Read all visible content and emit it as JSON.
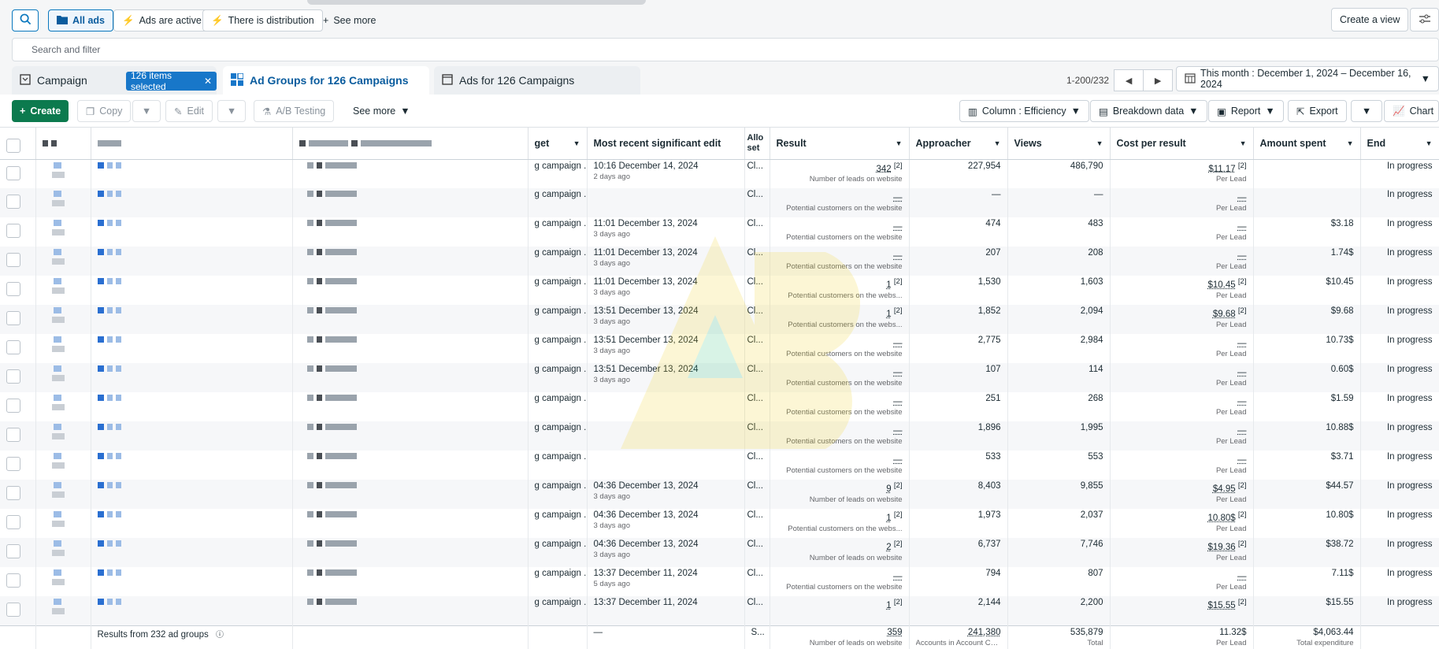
{
  "topbar": {
    "all_ads": "All ads",
    "ads_active": "Ads are active",
    "distribution": "There is distribution",
    "see_more": "See more",
    "create_view": "Create a view"
  },
  "search": {
    "placeholder": "Search and filter"
  },
  "tabs": {
    "campaign": "Campaign",
    "selected_badge": "126 items selected",
    "ad_groups": "Ad Groups for 126 Campaigns",
    "ads": "Ads for 126 Campaigns"
  },
  "pager": {
    "range": "1-200/232"
  },
  "date_range": "This month : December 1, 2024 – December 16, 2024",
  "toolbar": {
    "create": "Create",
    "copy": "Copy",
    "edit": "Edit",
    "ab_testing": "A/B Testing",
    "see_more": "See more",
    "column": "Column : Efficiency",
    "breakdown": "Breakdown data",
    "report": "Report",
    "export": "Export",
    "chart": "Chart"
  },
  "columns": {
    "target": "get",
    "recent_edit": "Most recent significant edit",
    "allocation": "Allo set",
    "result": "Result",
    "approacher": "Approacher",
    "views": "Views",
    "cost": "Cost per result",
    "spent": "Amount spent",
    "end": "End"
  },
  "rows": [
    {
      "target": "g campaign ...",
      "edit": "10:16 December 14, 2024",
      "edit_sub": "2 days ago",
      "alloc": "Cl...",
      "result": "342",
      "result_sup": "[2]",
      "result_sub": "Number of leads on website",
      "approacher": "227,954",
      "views": "486,790",
      "cost": "$11.17",
      "cost_sup": "[2]",
      "cost_sub": "Per Lead",
      "spent": "",
      "end": "In progress"
    },
    {
      "target": "g campaign ...",
      "edit": "",
      "edit_sub": "",
      "alloc": "Cl...",
      "result": "—",
      "result_sup": "",
      "result_sub": "Potential customers on the website",
      "approacher": "—",
      "views": "—",
      "cost": "—",
      "cost_sup": "",
      "cost_sub": "Per Lead",
      "spent": "",
      "end": "In progress"
    },
    {
      "target": "g campaign ...",
      "edit": "11:01 December 13, 2024",
      "edit_sub": "3 days ago",
      "alloc": "Cl...",
      "result": "—",
      "result_sup": "",
      "result_sub": "Potential customers on the website",
      "approacher": "474",
      "views": "483",
      "cost": "—",
      "cost_sup": "",
      "cost_sub": "Per Lead",
      "spent": "$3.18",
      "end": "In progress"
    },
    {
      "target": "g campaign ...",
      "edit": "11:01 December 13, 2024",
      "edit_sub": "3 days ago",
      "alloc": "Cl...",
      "result": "—",
      "result_sup": "",
      "result_sub": "Potential customers on the website",
      "approacher": "207",
      "views": "208",
      "cost": "—",
      "cost_sup": "",
      "cost_sub": "Per Lead",
      "spent": "1.74$",
      "end": "In progress"
    },
    {
      "target": "g campaign ...",
      "edit": "11:01 December 13, 2024",
      "edit_sub": "3 days ago",
      "alloc": "Cl...",
      "result": "1",
      "result_sup": "[2]",
      "result_sub": "Potential customers on the webs...",
      "approacher": "1,530",
      "views": "1,603",
      "cost": "$10.45",
      "cost_sup": "[2]",
      "cost_sub": "Per Lead",
      "spent": "$10.45",
      "end": "In progress"
    },
    {
      "target": "g campaign ...",
      "edit": "13:51 December 13, 2024",
      "edit_sub": "3 days ago",
      "alloc": "Cl...",
      "result": "1",
      "result_sup": "[2]",
      "result_sub": "Potential customers on the webs...",
      "approacher": "1,852",
      "views": "2,094",
      "cost": "$9.68",
      "cost_sup": "[2]",
      "cost_sub": "Per Lead",
      "spent": "$9.68",
      "end": "In progress"
    },
    {
      "target": "g campaign ...",
      "edit": "13:51 December 13, 2024",
      "edit_sub": "3 days ago",
      "alloc": "Cl...",
      "result": "—",
      "result_sup": "",
      "result_sub": "Potential customers on the website",
      "approacher": "2,775",
      "views": "2,984",
      "cost": "—",
      "cost_sup": "",
      "cost_sub": "Per Lead",
      "spent": "10.73$",
      "end": "In progress"
    },
    {
      "target": "g campaign ...",
      "edit": "13:51 December 13, 2024",
      "edit_sub": "3 days ago",
      "alloc": "Cl...",
      "result": "—",
      "result_sup": "",
      "result_sub": "Potential customers on the website",
      "approacher": "107",
      "views": "114",
      "cost": "—",
      "cost_sup": "",
      "cost_sub": "Per Lead",
      "spent": "0.60$",
      "end": "In progress"
    },
    {
      "target": "g campaign ...",
      "edit": "",
      "edit_sub": "",
      "alloc": "Cl...",
      "result": "—",
      "result_sup": "",
      "result_sub": "Potential customers on the website",
      "approacher": "251",
      "views": "268",
      "cost": "—",
      "cost_sup": "",
      "cost_sub": "Per Lead",
      "spent": "$1.59",
      "end": "In progress"
    },
    {
      "target": "g campaign ...",
      "edit": "",
      "edit_sub": "",
      "alloc": "Cl...",
      "result": "—",
      "result_sup": "",
      "result_sub": "Potential customers on the website",
      "approacher": "1,896",
      "views": "1,995",
      "cost": "—",
      "cost_sup": "",
      "cost_sub": "Per Lead",
      "spent": "10.88$",
      "end": "In progress"
    },
    {
      "target": "g campaign ...",
      "edit": "",
      "edit_sub": "",
      "alloc": "Cl...",
      "result": "—",
      "result_sup": "",
      "result_sub": "Potential customers on the website",
      "approacher": "533",
      "views": "553",
      "cost": "—",
      "cost_sup": "",
      "cost_sub": "Per Lead",
      "spent": "$3.71",
      "end": "In progress"
    },
    {
      "target": "g campaign ...",
      "edit": "04:36 December 13, 2024",
      "edit_sub": "3 days ago",
      "alloc": "Cl...",
      "result": "9",
      "result_sup": "[2]",
      "result_sub": "Number of leads on website",
      "approacher": "8,403",
      "views": "9,855",
      "cost": "$4.95",
      "cost_sup": "[2]",
      "cost_sub": "Per Lead",
      "spent": "$44.57",
      "end": "In progress"
    },
    {
      "target": "g campaign ...",
      "edit": "04:36 December 13, 2024",
      "edit_sub": "3 days ago",
      "alloc": "Cl...",
      "result": "1",
      "result_sup": "[2]",
      "result_sub": "Potential customers on the webs...",
      "approacher": "1,973",
      "views": "2,037",
      "cost": "10.80$",
      "cost_sup": "[2]",
      "cost_sub": "Per Lead",
      "spent": "10.80$",
      "end": "In progress"
    },
    {
      "target": "g campaign ...",
      "edit": "04:36 December 13, 2024",
      "edit_sub": "3 days ago",
      "alloc": "Cl...",
      "result": "2",
      "result_sup": "[2]",
      "result_sub": "Number of leads on website",
      "approacher": "6,737",
      "views": "7,746",
      "cost": "$19.36",
      "cost_sup": "[2]",
      "cost_sub": "Per Lead",
      "spent": "$38.72",
      "end": "In progress"
    },
    {
      "target": "g campaign ...",
      "edit": "13:37 December 11, 2024",
      "edit_sub": "5 days ago",
      "alloc": "Cl...",
      "result": "—",
      "result_sup": "",
      "result_sub": "Potential customers on the website",
      "approacher": "794",
      "views": "807",
      "cost": "—",
      "cost_sup": "",
      "cost_sub": "Per Lead",
      "spent": "7.11$",
      "end": "In progress"
    },
    {
      "target": "g campaign ...",
      "edit": "13:37 December 11, 2024",
      "edit_sub": "",
      "alloc": "Cl...",
      "result": "1",
      "result_sup": "[2]",
      "result_sub": "",
      "approacher": "2,144",
      "views": "2,200",
      "cost": "$15.55",
      "cost_sup": "[2]",
      "cost_sub": "",
      "spent": "$15.55",
      "end": "In progress"
    }
  ],
  "footer": {
    "results_label": "Results from 232 ad groups",
    "edit": "—",
    "alloc": "S...",
    "result": "359",
    "result_sub": "Number of leads on website",
    "approacher": "241,380",
    "approacher_sub": "Accounts in Account Cen...",
    "views": "535,879",
    "views_sub": "Total",
    "cost": "11.32$",
    "cost_sub": "Per Lead",
    "spent": "$4,063.44",
    "spent_sub": "Total expenditure"
  }
}
